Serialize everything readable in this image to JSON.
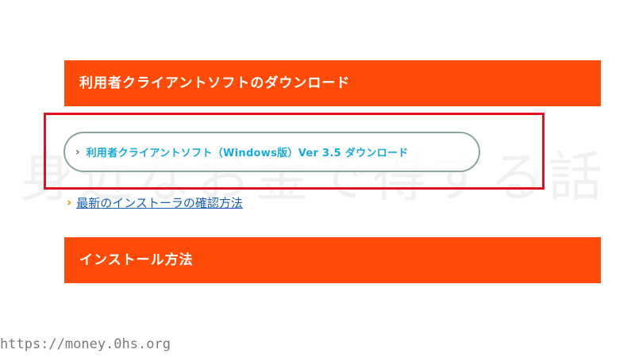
{
  "background_watermark": {
    "text": "身近なお金で得する話"
  },
  "sections": {
    "download_header": "利用者クライアントソフトのダウンロード",
    "install_header": "インストール方法"
  },
  "download_button": {
    "label": "利用者クライアントソフト（Windows版）Ver 3.5 ダウンロード",
    "chevron": "›"
  },
  "info_link": {
    "label": "最新のインストーラの確認方法",
    "chevron": "›"
  },
  "site_url": "https://money.0hs.org",
  "colors": {
    "header_bg": "#fe4b08",
    "highlight_border": "#e0101f",
    "button_text": "#18a8df",
    "link": "#1a5fb4",
    "link_chevron": "#f08a00"
  }
}
